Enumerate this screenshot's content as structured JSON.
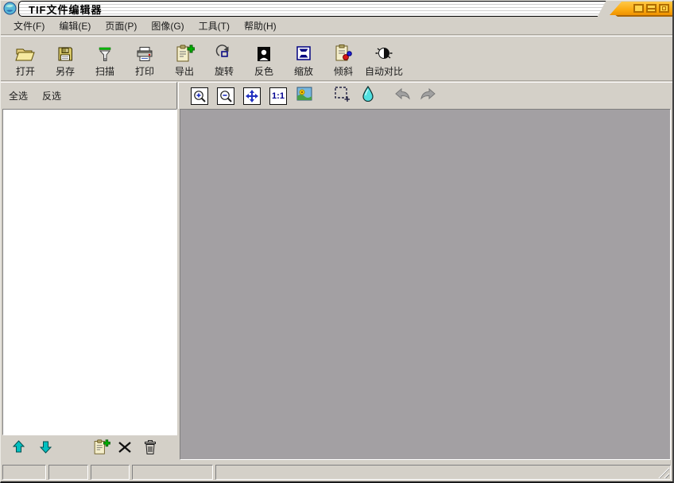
{
  "window": {
    "title": "TIF文件编辑器",
    "icon": "globe-icon",
    "controls": [
      {
        "name": "minimize",
        "glyph": "box"
      },
      {
        "name": "maximize",
        "glyph": "split-box"
      },
      {
        "name": "close",
        "glyph": "nested-box"
      }
    ]
  },
  "menu": {
    "items": [
      {
        "label": "文件(F)"
      },
      {
        "label": "编辑(E)"
      },
      {
        "label": "页面(P)"
      },
      {
        "label": "图像(G)"
      },
      {
        "label": "工具(T)"
      },
      {
        "label": "帮助(H)"
      }
    ]
  },
  "toolbar": {
    "buttons": [
      {
        "label": "打开",
        "icon": "open-folder-icon"
      },
      {
        "label": "另存",
        "icon": "save-as-floppy-icon"
      },
      {
        "label": "扫描",
        "icon": "scan-icon"
      },
      {
        "label": "打印",
        "icon": "print-icon"
      },
      {
        "label": "导出",
        "icon": "export-icon"
      },
      {
        "label": "旋转",
        "icon": "rotate-icon"
      },
      {
        "label": "反色",
        "icon": "invert-color-icon"
      },
      {
        "label": "缩放",
        "icon": "zoom-scale-icon"
      },
      {
        "label": "倾斜",
        "icon": "deskew-icon"
      },
      {
        "label": "自动对比",
        "icon": "auto-contrast-icon"
      }
    ]
  },
  "page_list": {
    "select_all_label": "全选",
    "invert_selection_label": "反选",
    "thumbnails": []
  },
  "view_toolbar": {
    "actual_size_label": "1:1",
    "buttons": [
      {
        "icon": "zoom-in-icon",
        "enabled": true
      },
      {
        "icon": "zoom-out-icon",
        "enabled": true
      },
      {
        "icon": "fit-window-icon",
        "enabled": true
      },
      {
        "icon": "actual-size-icon",
        "enabled": true
      },
      {
        "icon": "image-view-icon",
        "enabled": true
      },
      {
        "icon": "select-region-icon",
        "enabled": true
      },
      {
        "icon": "fill-droplet-icon",
        "enabled": true
      },
      {
        "icon": "undo-icon",
        "enabled": false
      },
      {
        "icon": "redo-icon",
        "enabled": false
      }
    ]
  },
  "page_actions": {
    "buttons": [
      {
        "icon": "move-up-icon"
      },
      {
        "icon": "move-down-icon"
      },
      {
        "icon": "copy-page-icon"
      },
      {
        "icon": "delete-x-icon"
      },
      {
        "icon": "trash-icon"
      }
    ]
  },
  "status_bar": {
    "panels": [
      "",
      "",
      "",
      "",
      ""
    ]
  },
  "colors": {
    "window_bg": "#d4d0c8",
    "canvas_bg": "#a3a0a3",
    "titlebar_accent_top": "#ffc848",
    "titlebar_accent_bottom": "#ef9200",
    "control_button_fill": "#ffd24a",
    "control_button_border": "#b06c00",
    "navy": "#000090",
    "teal_arrow": "#00c0c0",
    "droplet_cyan": "#50e0e0"
  }
}
